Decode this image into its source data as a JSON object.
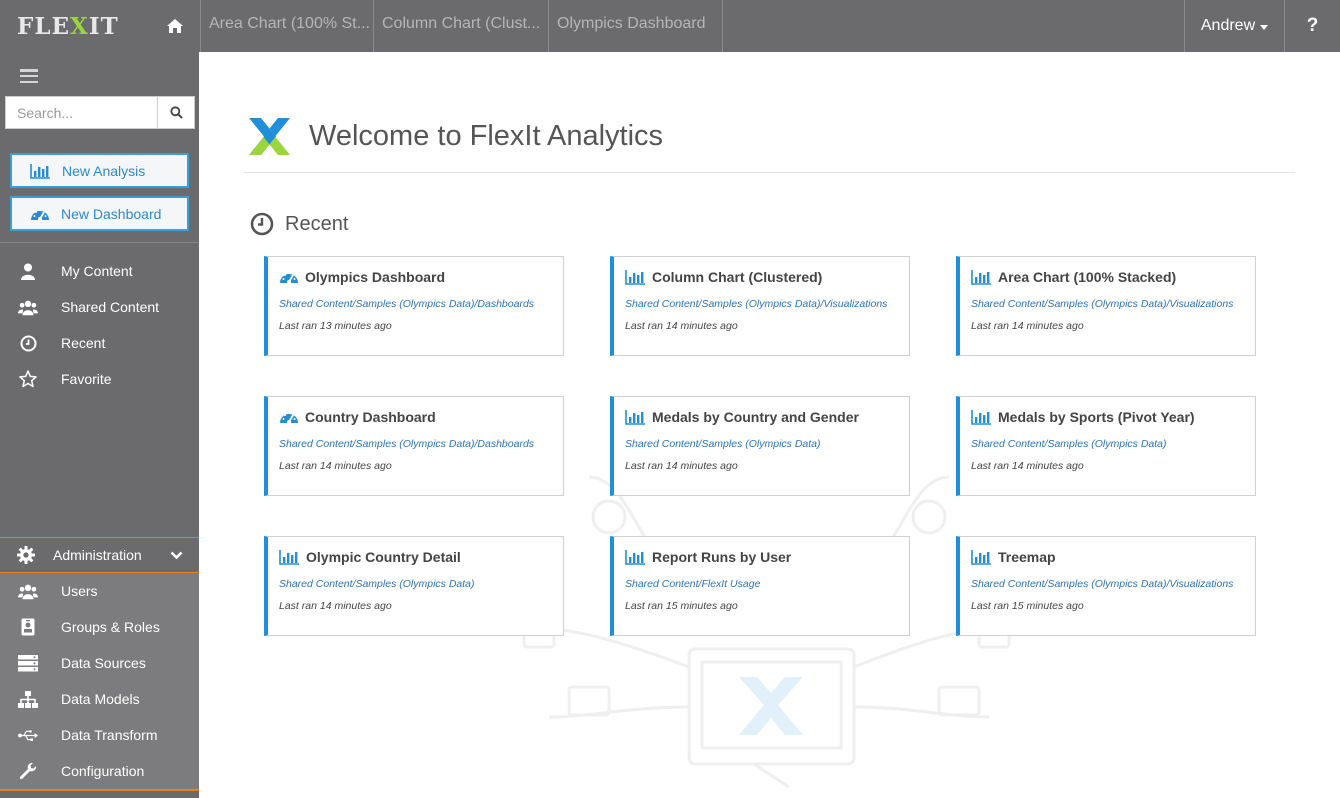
{
  "brand": {
    "logo_prefix": "FLE",
    "logo_x": "X",
    "logo_suffix": "IT",
    "accent": "#9bd53c"
  },
  "topbar": {
    "home_icon": "home-icon",
    "tabs": [
      {
        "label": "Area Chart (100% St..."
      },
      {
        "label": "Column Chart (Clust..."
      },
      {
        "label": "Olympics Dashboard"
      }
    ],
    "user_label": "Andrew",
    "help_label": "?"
  },
  "sidebar": {
    "search_placeholder": "Search...",
    "new_analysis": "New Analysis",
    "new_dashboard": "New Dashboard",
    "nav": [
      {
        "label": "My Content",
        "icon": "user-icon"
      },
      {
        "label": "Shared Content",
        "icon": "users-icon"
      },
      {
        "label": "Recent",
        "icon": "clock-icon"
      },
      {
        "label": "Favorite",
        "icon": "star-icon"
      }
    ],
    "admin_label": "Administration",
    "admin_items": [
      {
        "label": "Users",
        "icon": "users-icon"
      },
      {
        "label": "Groups & Roles",
        "icon": "id-badge-icon"
      },
      {
        "label": "Data Sources",
        "icon": "server-icon"
      },
      {
        "label": "Data Models",
        "icon": "sitemap-icon"
      },
      {
        "label": "Data Transform",
        "icon": "usb-icon"
      },
      {
        "label": "Configuration",
        "icon": "wrench-icon"
      }
    ],
    "accent": "#e4821e"
  },
  "main": {
    "welcome_title": "Welcome to FlexIt Analytics",
    "recent_title": "Recent",
    "card_accent": "#1f8fd8",
    "cards": [
      {
        "title": "Olympics Dashboard",
        "icon": "dashboard-icon",
        "path": "Shared Content/Samples (Olympics Data)/Dashboards",
        "last_ran": "Last ran 13 minutes ago"
      },
      {
        "title": "Column Chart (Clustered)",
        "icon": "bar-chart-icon",
        "path": "Shared Content/Samples (Olympics Data)/Visualizations",
        "last_ran": "Last ran 14 minutes ago"
      },
      {
        "title": "Area Chart (100% Stacked)",
        "icon": "bar-chart-icon",
        "path": "Shared Content/Samples (Olympics Data)/Visualizations",
        "last_ran": "Last ran 14 minutes ago"
      },
      {
        "title": "Country Dashboard",
        "icon": "dashboard-icon",
        "path": "Shared Content/Samples (Olympics Data)/Dashboards",
        "last_ran": "Last ran 14 minutes ago"
      },
      {
        "title": "Medals by Country and Gender",
        "icon": "bar-chart-icon",
        "path": "Shared Content/Samples (Olympics Data)",
        "last_ran": "Last ran 14 minutes ago"
      },
      {
        "title": "Medals by Sports (Pivot Year)",
        "icon": "bar-chart-icon",
        "path": "Shared Content/Samples (Olympics Data)",
        "last_ran": "Last ran 14 minutes ago"
      },
      {
        "title": "Olympic Country Detail",
        "icon": "bar-chart-icon",
        "path": "Shared Content/Samples (Olympics Data)",
        "last_ran": "Last ran 14 minutes ago"
      },
      {
        "title": "Report Runs by User",
        "icon": "bar-chart-icon",
        "path": "Shared Content/FlexIt Usage",
        "last_ran": "Last ran 15 minutes ago"
      },
      {
        "title": "Treemap",
        "icon": "bar-chart-icon",
        "path": "Shared Content/Samples (Olympics Data)/Visualizations",
        "last_ran": "Last ran 15 minutes ago"
      }
    ]
  }
}
